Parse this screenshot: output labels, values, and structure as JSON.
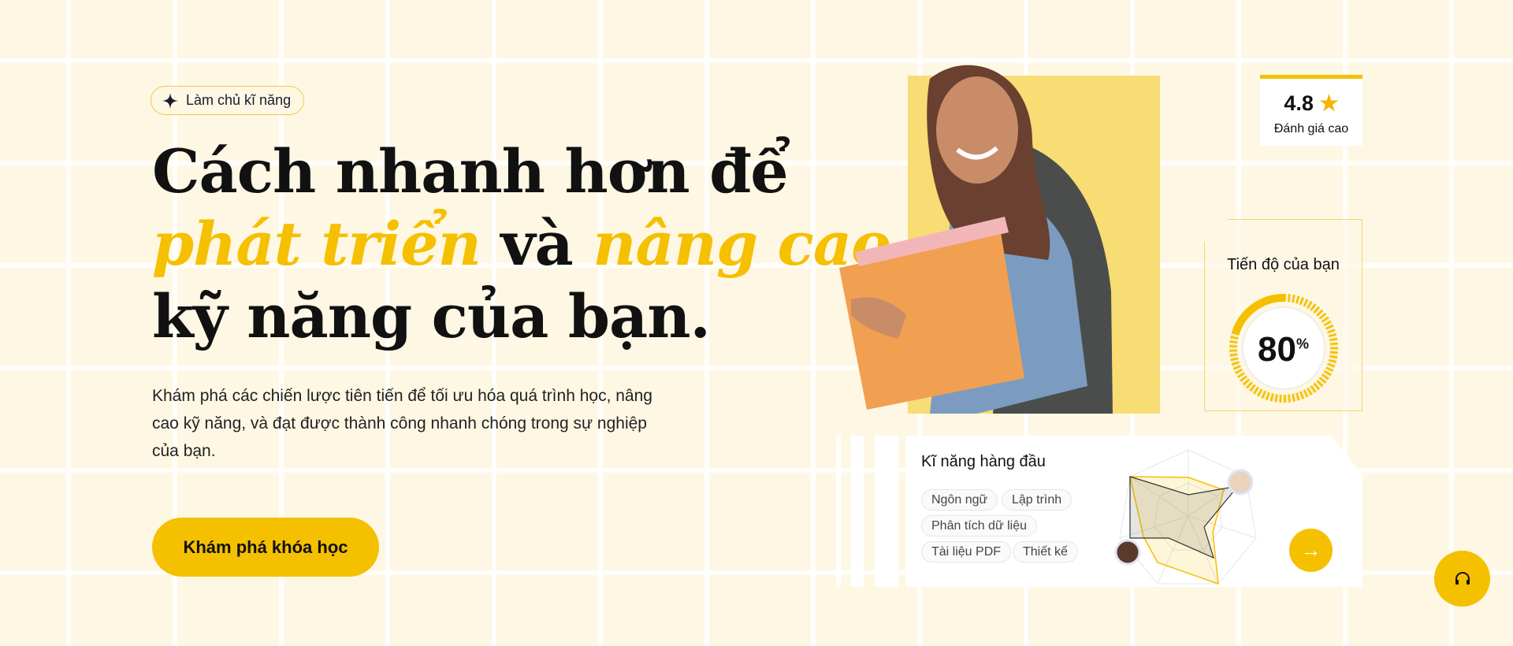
{
  "hero": {
    "badge": "Làm chủ kĩ năng",
    "headline": {
      "line1": "Cách nhanh hơn để",
      "accent1": "phát triển",
      "mid": "và",
      "accent2": "nâng cao",
      "line3": "kỹ năng của bạn."
    },
    "description": "Khám phá các chiến lược tiên tiến để tối ưu hóa quá trình học, nâng cao kỹ năng, và đạt được thành công nhanh chóng trong sự nghiệp của bạn.",
    "cta_label": "Khám phá khóa học"
  },
  "rating": {
    "value": "4.8",
    "label": "Đánh giá cao",
    "icon": "star-icon"
  },
  "progress": {
    "title": "Tiến độ của bạn",
    "value": "80",
    "unit": "%",
    "percent": 80
  },
  "skills": {
    "title": "Kĩ năng hàng đầu",
    "tags": [
      "Ngôn ngữ",
      "Lập trình",
      "Phân tích dữ liệu",
      "Tài liệu PDF",
      "Thiết kế"
    ]
  },
  "colors": {
    "accent": "#f5c000",
    "background": "#fdf7e4",
    "text": "#111111"
  }
}
